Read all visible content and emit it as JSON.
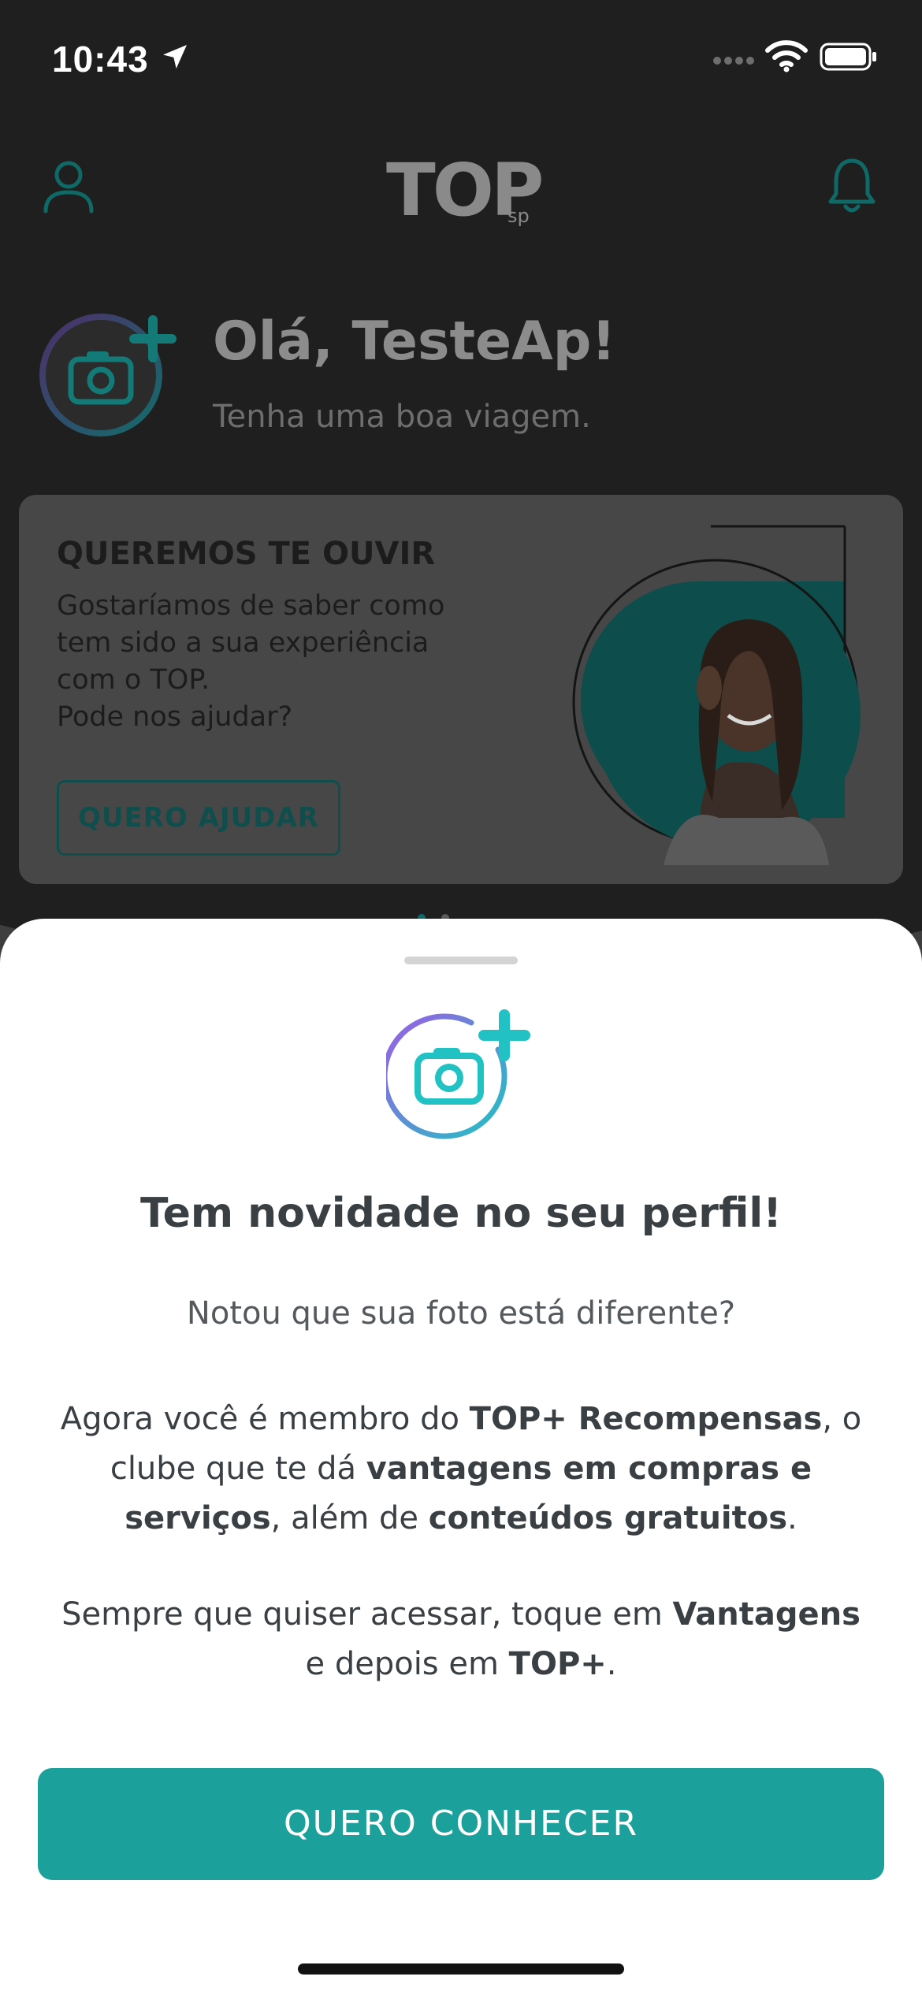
{
  "status_bar": {
    "time": "10:43",
    "icons": [
      "location-arrow-icon",
      "cellular-dots-icon",
      "wifi-icon",
      "battery-icon"
    ]
  },
  "header": {
    "logo_main": "TOP",
    "logo_sub": "sp",
    "icons": [
      "profile-icon",
      "bell-icon"
    ]
  },
  "greeting": {
    "title": "Olá, TesteAp!",
    "subtitle": "Tenha uma boa viagem."
  },
  "survey_card": {
    "title": "QUEREMOS TE OUVIR",
    "body_lines": [
      "Gostaríamos de saber como",
      "tem sido a sua experiência",
      "com o TOP.",
      "Pode nos ajudar?"
    ],
    "button_label": "QUERO AJUDAR"
  },
  "sheet": {
    "title": "Tem novidade no seu perfil!",
    "question": "Notou que sua foto está diferente?",
    "para1": {
      "t1": "Agora você é membro do ",
      "b1": "TOP+ Recompensas",
      "t2": ", o clube que te dá ",
      "b2": "vantagens em compras e serviços",
      "t3": ", além de ",
      "b3": "conteúdos gratuitos",
      "t4": "."
    },
    "para2": {
      "t1": "Sempre que quiser acessar, toque em ",
      "b1": "Vantagens",
      "t2": " e depois em ",
      "b2": "TOP+",
      "t3": "."
    },
    "cta_label": "QUERO CONHECER"
  },
  "colors": {
    "accent": "#1ba09c",
    "accent_dark": "#0f4e4c",
    "text_dark": "#3a3f44",
    "gradient_purple": "#9b5de5",
    "gradient_teal": "#22c1c3"
  }
}
